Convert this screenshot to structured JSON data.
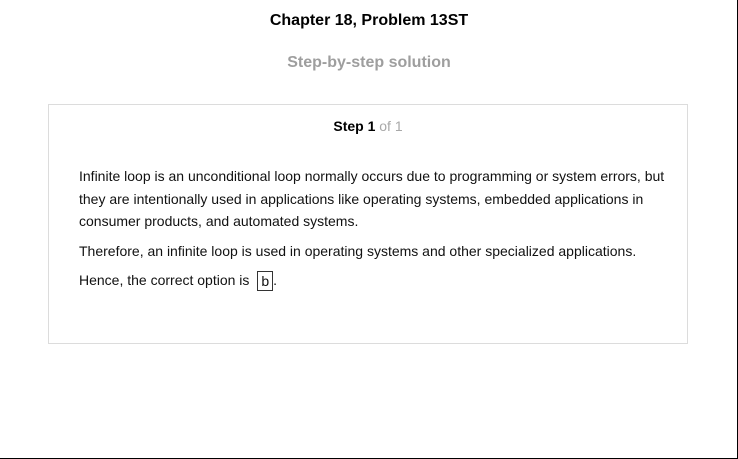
{
  "header": {
    "title": "Chapter 18, Problem 13ST",
    "subtitle": "Step-by-step solution"
  },
  "step": {
    "label": "Step 1",
    "of": "of 1"
  },
  "content": {
    "para1": "Infinite loop is an unconditional loop normally occurs due to programming or system errors, but they are intentionally used in applications like operating systems, embedded applications in consumer products, and automated systems.",
    "para2": "Therefore, an infinite loop is used in operating systems and other specialized applications.",
    "para3_prefix": "Hence, the correct option is",
    "answer": "b",
    "para3_suffix": "."
  }
}
